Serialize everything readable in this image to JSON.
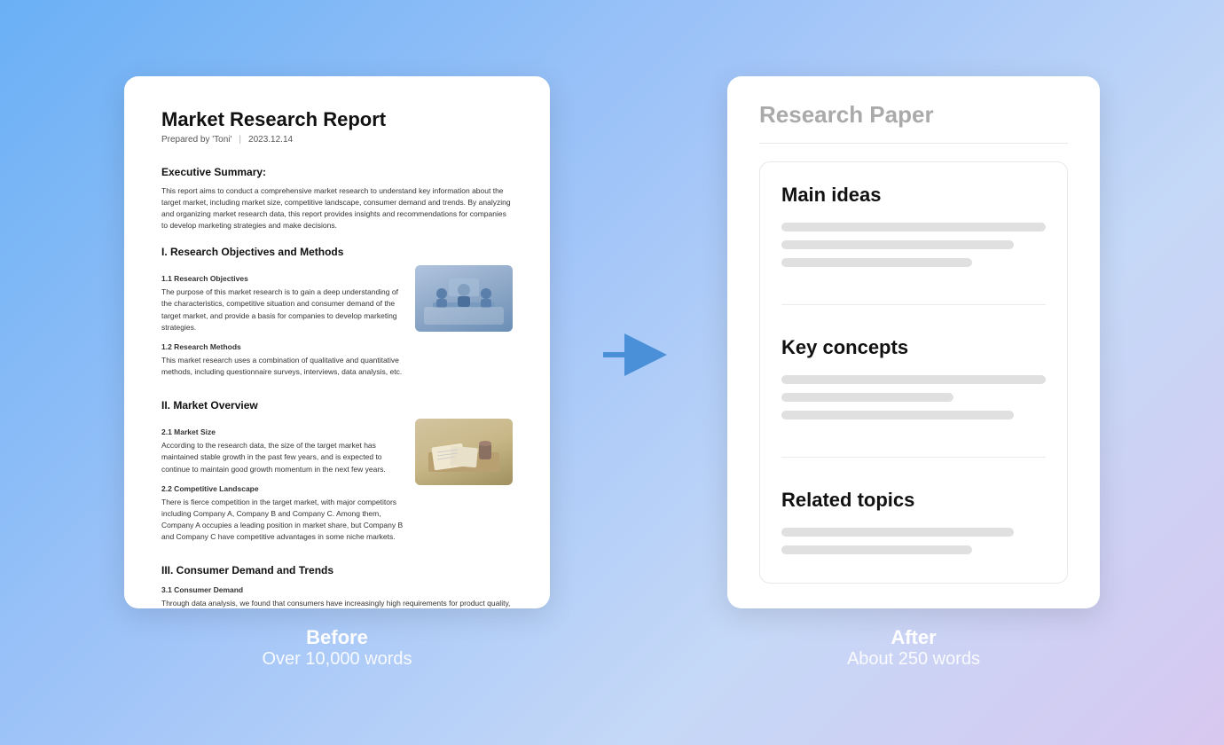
{
  "before": {
    "label_top": "Before",
    "label_bottom": "Over 10,000 words",
    "document": {
      "title": "Market Research Report",
      "subtitle_author": "Prepared by 'Toni'",
      "subtitle_sep": "|",
      "subtitle_date": "2023.12.14",
      "sections": [
        {
          "heading": "Executive Summary:",
          "body": "This report aims to conduct a comprehensive market research to understand key information about the target market, including market size, competitive landscape, consumer demand and trends. By analyzing and organizing market research data, this report provides insights and recommendations for companies to develop marketing strategies and make decisions."
        },
        {
          "heading": "I. Research Objectives and Methods",
          "subsections": [
            {
              "sub_title": "1.1 Research Objectives",
              "body": "The purpose of this market research is to gain a deep understanding of the characteristics, competitive situation and consumer demand of the target market, and provide a basis for companies to develop marketing strategies.",
              "has_image": true,
              "image_type": "meeting"
            },
            {
              "sub_title": "1.2 Research Methods",
              "body": "This market research uses a combination of qualitative and quantitative methods, including questionnaire surveys, interviews, data analysis, etc.",
              "has_image": false
            }
          ]
        },
        {
          "heading": "II. Market Overview",
          "subsections": [
            {
              "sub_title": "2.1 Market Size",
              "body": "According to the research data, the size of the target market has maintained stable growth in the past few years, and is expected to continue to maintain good growth momentum in the next few years.",
              "has_image": true,
              "image_type": "desk"
            },
            {
              "sub_title": "2.2 Competitive Landscape",
              "body": "There is fierce competition in the target market, with major competitors including Company A, Company B and Company C. Among them, Company A occupies a leading position in market share, but Company B and Company C have competitive advantages in some niche markets.",
              "has_image": false
            }
          ]
        },
        {
          "heading": "III. Consumer Demand and Trends",
          "subsections": [
            {
              "sub_title": "3.1 Consumer Demand",
              "body": "Through data analysis, we found that consumers have increasingly high requirements for product quality, reasonable prices and after-sales service. In addition, personalized customization and green environmental protection have also become the focus of consumer attention.",
              "has_image": false
            }
          ]
        }
      ]
    }
  },
  "after": {
    "label_top": "After",
    "label_bottom": "About 250 words",
    "card_title": "Research Paper",
    "sections": [
      {
        "heading": "Main ideas",
        "lines": [
          "full",
          "long",
          "medium"
        ]
      },
      {
        "heading": "Key concepts",
        "lines": [
          "full",
          "short",
          "long"
        ]
      },
      {
        "heading": "Related topics",
        "lines": [
          "long",
          "medium"
        ]
      }
    ]
  },
  "arrow": {
    "color": "#4a90d9"
  }
}
